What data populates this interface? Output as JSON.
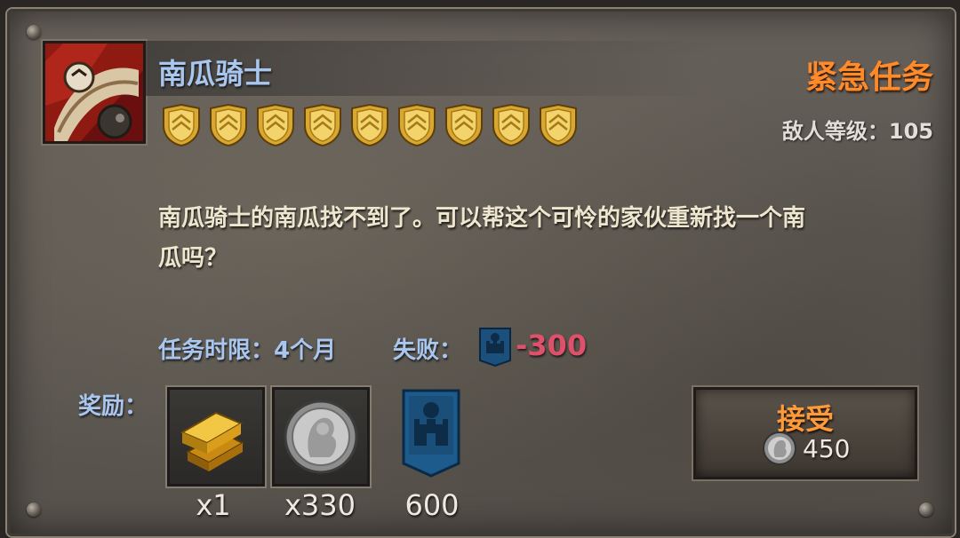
{
  "quest": {
    "name": "南瓜骑士",
    "type_label": "紧急任务",
    "enemy_level_label": "敌人等级：105",
    "difficulty_stars": 9,
    "description_line1": "南瓜骑士的南瓜找不到了。可以帮这个可怜的家伙重新找一个南",
    "description_line2": "瓜吗？",
    "time_limit": "任务时限：4个月",
    "fail_label": "失败：",
    "fail_value": "-300"
  },
  "rewards": {
    "label": "奖励：",
    "items": [
      {
        "icon": "gold-bar-icon",
        "quantity": "x1"
      },
      {
        "icon": "silver-coin-icon",
        "quantity": "x330"
      },
      {
        "icon": "fortress-banner-icon",
        "quantity": "600"
      }
    ]
  },
  "accept": {
    "label": "接受",
    "cost_icon": "silver-coin-icon",
    "cost_value": "450"
  },
  "colors": {
    "name": "#a9c6ee",
    "urgent": "#ff8a2a",
    "fail_value": "#e0506a",
    "accept_label": "#ff9a3a",
    "description": "#efe6cf"
  }
}
